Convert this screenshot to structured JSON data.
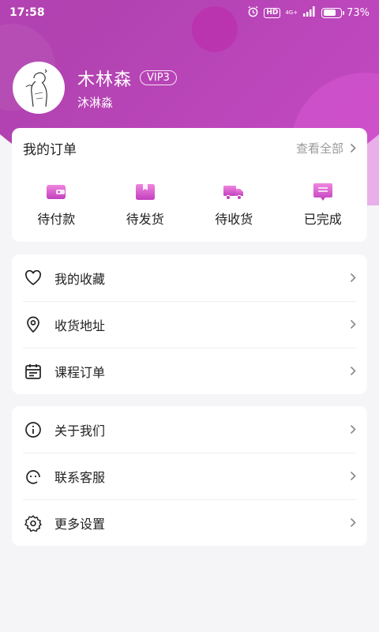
{
  "status": {
    "time": "17:58",
    "network": "4G+",
    "battery": "73%",
    "battery_level": 0.73
  },
  "profile": {
    "name": "木林森",
    "vip": "VIP3",
    "nickname": "沐淋淼"
  },
  "orders": {
    "title": "我的订单",
    "more": "查看全部",
    "items": [
      {
        "label": "待付款",
        "icon": "wallet-icon"
      },
      {
        "label": "待发货",
        "icon": "package-icon"
      },
      {
        "label": "待收货",
        "icon": "truck-icon"
      },
      {
        "label": "已完成",
        "icon": "message-check-icon"
      }
    ]
  },
  "menu1": [
    {
      "label": "我的收藏",
      "icon": "heart-icon"
    },
    {
      "label": "收货地址",
      "icon": "location-pin-icon"
    },
    {
      "label": "课程订单",
      "icon": "calendar-icon"
    }
  ],
  "menu2": [
    {
      "label": "关于我们",
      "icon": "info-icon"
    },
    {
      "label": "联系客服",
      "icon": "customer-service-icon"
    },
    {
      "label": "更多设置",
      "icon": "settings-gear-icon"
    }
  ],
  "colors": {
    "brand": "#c23fbd",
    "brand_light": "#e879d6"
  }
}
